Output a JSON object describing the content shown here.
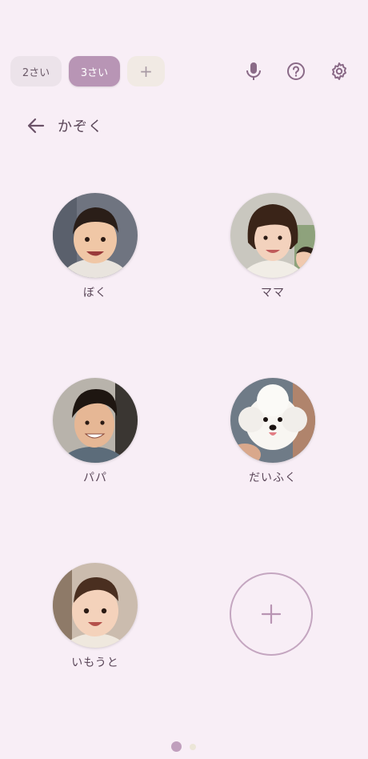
{
  "tabs": [
    {
      "label": "2さい",
      "active": false
    },
    {
      "label": "3さい",
      "active": true
    },
    {
      "label": "+",
      "active": false
    }
  ],
  "toolbar": {
    "icons": [
      "microphone-icon",
      "help-icon",
      "settings-icon"
    ]
  },
  "header": {
    "back_icon": "arrow-left-icon",
    "title": "かぞく"
  },
  "members": [
    {
      "label": "ぼく"
    },
    {
      "label": "ママ"
    },
    {
      "label": "パパ"
    },
    {
      "label": "だいふく"
    },
    {
      "label": "いもうと"
    }
  ],
  "add_member": {
    "icon": "plus-icon"
  },
  "pagination": {
    "current": 1,
    "total": 2
  },
  "colors": {
    "background": "#f8eef6",
    "accent": "#b895b5",
    "text": "#5a4658"
  }
}
